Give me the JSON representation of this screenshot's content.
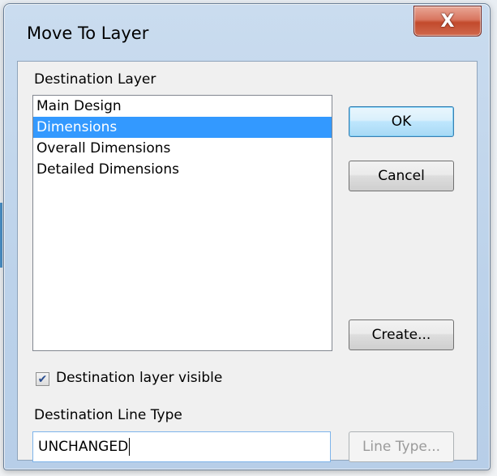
{
  "window": {
    "title": "Move To Layer",
    "close_glyph": "X"
  },
  "destination_layer": {
    "label": "Destination Layer",
    "items": [
      {
        "label": "Main Design",
        "selected": false
      },
      {
        "label": "Dimensions",
        "selected": true
      },
      {
        "label": "Overall Dimensions",
        "selected": false
      },
      {
        "label": "Detailed Dimensions",
        "selected": false
      }
    ]
  },
  "buttons": {
    "ok": "OK",
    "cancel": "Cancel",
    "create": "Create...",
    "line_type": "Line Type..."
  },
  "visible_checkbox": {
    "label": "Destination layer visible",
    "checked": true
  },
  "line_type": {
    "label": "Destination Line Type",
    "value": "UNCHANGED"
  },
  "colors": {
    "selection": "#3399ff",
    "close_button": "#c24a2c",
    "frame": "#bcd2ea"
  }
}
